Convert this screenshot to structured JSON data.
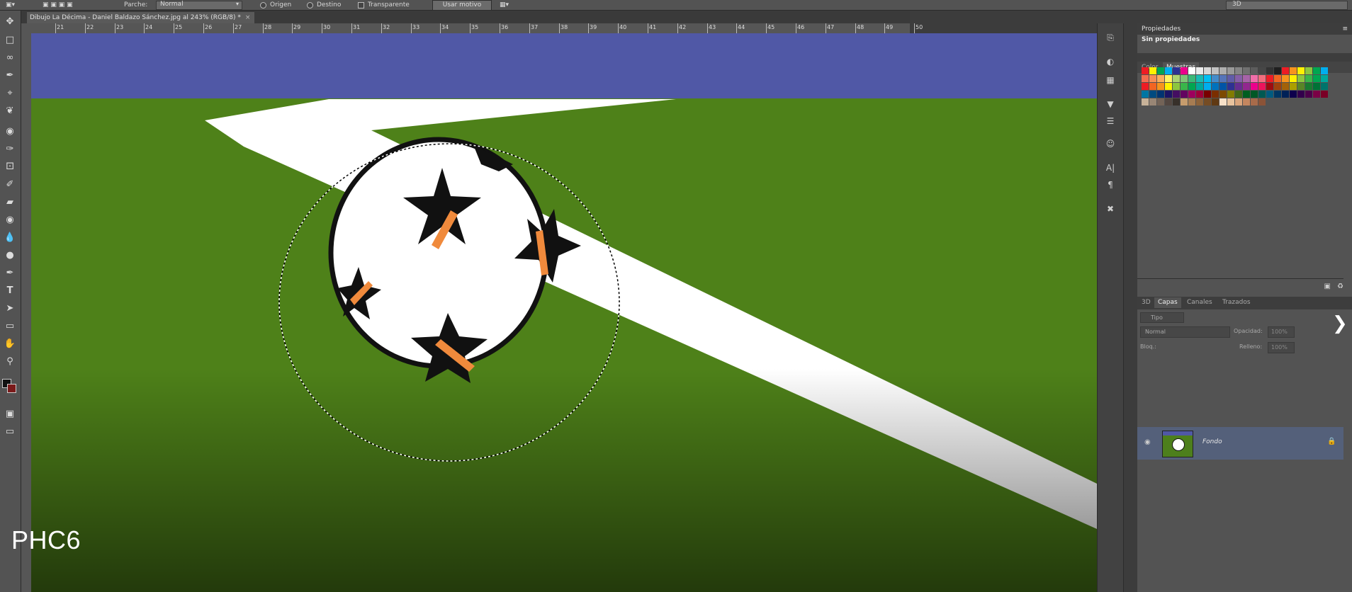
{
  "options_bar": {
    "parche_label": "Parche:",
    "parche_value": "Normal",
    "origen_label": "Origen",
    "destino_label": "Destino",
    "transparente_label": "Transparente",
    "usar_motivo_label": "Usar motivo",
    "workspace_value": "3D"
  },
  "document": {
    "tab_title": "Dibujo La Décima - Daniel Baldazo Sánchez.jpg al 243% (RGB/8) *",
    "ruler_ticks": [
      "21",
      "22",
      "23",
      "24",
      "25",
      "26",
      "27",
      "28",
      "29",
      "30",
      "31",
      "32",
      "33",
      "34",
      "35",
      "36",
      "37",
      "38",
      "39",
      "40",
      "41",
      "42",
      "43",
      "44",
      "45",
      "46",
      "47",
      "48",
      "49",
      "50"
    ]
  },
  "panels": {
    "properties": {
      "title": "Propiedades",
      "empty_text": "Sin propiedades"
    },
    "swatches": {
      "tab_color": "Color",
      "tab_muestras": "Muestras"
    },
    "layers": {
      "tab_3d": "3D",
      "tab_capas": "Capas",
      "tab_canales": "Canales",
      "tab_trazados": "Trazados",
      "filter_label": "Tipo",
      "blend_mode": "Normal",
      "opacity_label": "Opacidad:",
      "opacity_value": "100%",
      "lock_label": "Bloq.:",
      "fill_label": "Relleno:",
      "fill_value": "100%",
      "layer_name": "Fondo"
    }
  },
  "overlay": {
    "watermark": "PHC6"
  },
  "colors": {
    "sky": "#5058a6",
    "grass": "#4e8119",
    "line": "#ffffff",
    "star_accent": "#f08a3c"
  },
  "icons": [
    "move-icon",
    "marquee-icon",
    "lasso-icon",
    "quick-select-icon",
    "crop-icon",
    "eyedropper-icon",
    "healing-icon",
    "brush-icon",
    "stamp-icon",
    "history-brush-icon",
    "eraser-icon",
    "bucket-icon",
    "blur-icon",
    "dodge-icon",
    "pen-icon",
    "type-icon",
    "path-select-icon",
    "shape-icon",
    "hand-icon",
    "zoom-icon"
  ]
}
